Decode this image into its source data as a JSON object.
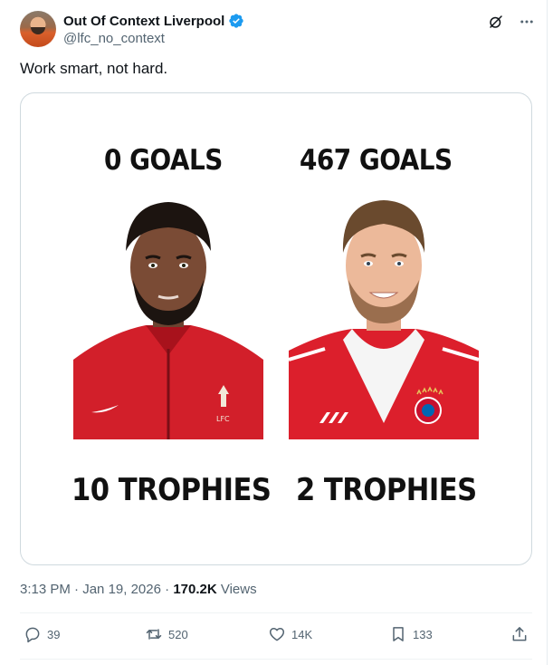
{
  "author": {
    "display_name": "Out Of Context Liverpool",
    "handle": "@lfc_no_context",
    "verified_color": "#1d9bf0"
  },
  "tweet": {
    "text": "Work smart, not hard."
  },
  "media": {
    "left": {
      "goals": "0 GOALS",
      "trophies": "10 TROPHIES",
      "kit_color": "#d21f2a"
    },
    "right": {
      "goals": "467 GOALS",
      "trophies": "2 TROPHIES",
      "kit_color": "#dc1f2c"
    }
  },
  "meta": {
    "time": "3:13 PM",
    "date": "Jan 19, 2026",
    "views_count": "170.2K",
    "views_label": "Views"
  },
  "actions": {
    "replies": "39",
    "retweets": "520",
    "likes": "14K",
    "bookmarks": "133"
  },
  "icons": {
    "header": [
      "grok-icon",
      "more-icon"
    ],
    "actions": [
      "reply-icon",
      "retweet-icon",
      "like-icon",
      "bookmark-icon",
      "share-icon"
    ]
  },
  "colors": {
    "text_primary": "#0f1419",
    "text_secondary": "#536471",
    "border": "#cfd9de"
  }
}
